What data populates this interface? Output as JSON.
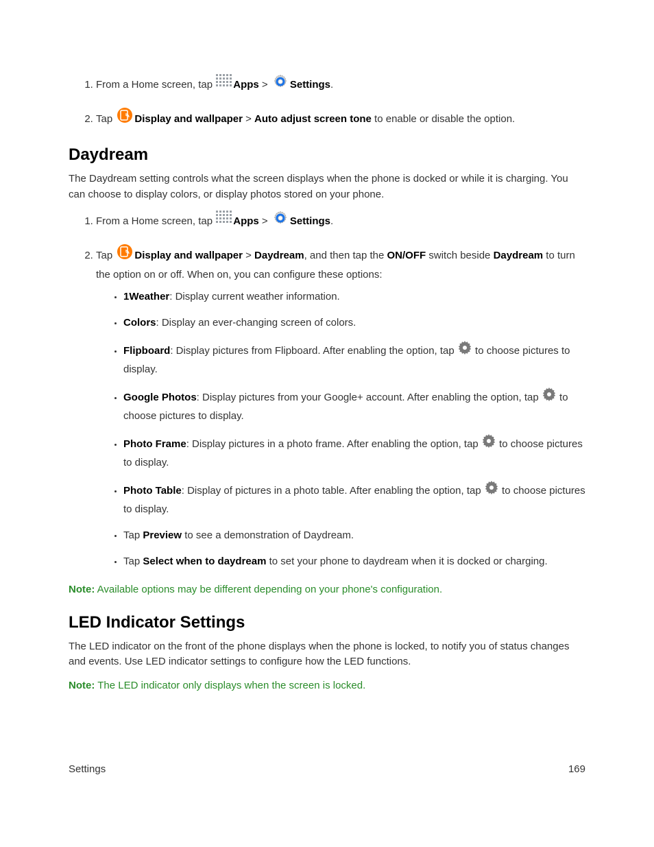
{
  "steps_a": {
    "s1_pre": "From a Home screen, tap ",
    "apps": "Apps",
    "gt": " > ",
    "settings": "Settings",
    "period": ".",
    "s2_pre": "Tap ",
    "display_wallpaper": "Display and wallpaper",
    "auto_adjust": "Auto adjust screen tone",
    "s2_post": " to enable or disable the option."
  },
  "daydream": {
    "heading": "Daydream",
    "intro": "The Daydream setting controls what the screen displays when the phone is docked or while it is charging. You can choose to display colors, or display photos stored on your phone.",
    "s1_pre": "From a Home screen, tap ",
    "apps": "Apps",
    "gt": " > ",
    "settings": "Settings",
    "period": ".",
    "s2_pre": "Tap ",
    "display_wallpaper": "Display and wallpaper",
    "daydream_b": "Daydream",
    "s2_mid": ", and then tap the ",
    "onoff": "ON/OFF",
    "s2_mid2": " switch beside ",
    "daydream_b2": "Daydream",
    "s2_post": " to turn the option on or off. When on, you can configure these options:",
    "opts": {
      "weather_b": "1Weather",
      "weather_t": ": Display current weather information.",
      "colors_b": "Colors",
      "colors_t": ": Display an ever-changing screen of colors.",
      "flip_b": "Flipboard",
      "flip_t1": ": Display pictures from Flipboard. After enabling the option, tap ",
      "flip_t2": " to choose pictures to display.",
      "gphotos_b": "Google Photos",
      "gphotos_t1": ": Display pictures from your Google+ account. After enabling the option, tap ",
      "gphotos_t2": " to choose pictures to display.",
      "pframe_b": "Photo Frame",
      "pframe_t1": ": Display pictures in a photo frame. After enabling the option, tap ",
      "pframe_t2": " to choose pictures to display.",
      "ptable_b": "Photo Table",
      "ptable_t1": ": Display of pictures in a photo table. After enabling the option, tap ",
      "ptable_t2": " to choose pictures to display.",
      "preview_pre": "Tap ",
      "preview_b": "Preview",
      "preview_t": " to see a demonstration of Daydream.",
      "select_pre": "Tap ",
      "select_b": "Select when to daydream",
      "select_t": " to set your phone to daydream when it is docked or charging."
    },
    "note_label": "Note:",
    "note_text": " Available options may be different depending on your phone's configuration."
  },
  "led": {
    "heading": "LED Indicator Settings",
    "intro": "The LED indicator on the front of the phone displays when the phone is locked, to notify you of status changes and events. Use LED indicator settings to configure how the LED functions.",
    "note_label": "Note:",
    "note_text": " The LED indicator only displays when the screen is locked."
  },
  "footer": {
    "section": "Settings",
    "page": "169"
  }
}
